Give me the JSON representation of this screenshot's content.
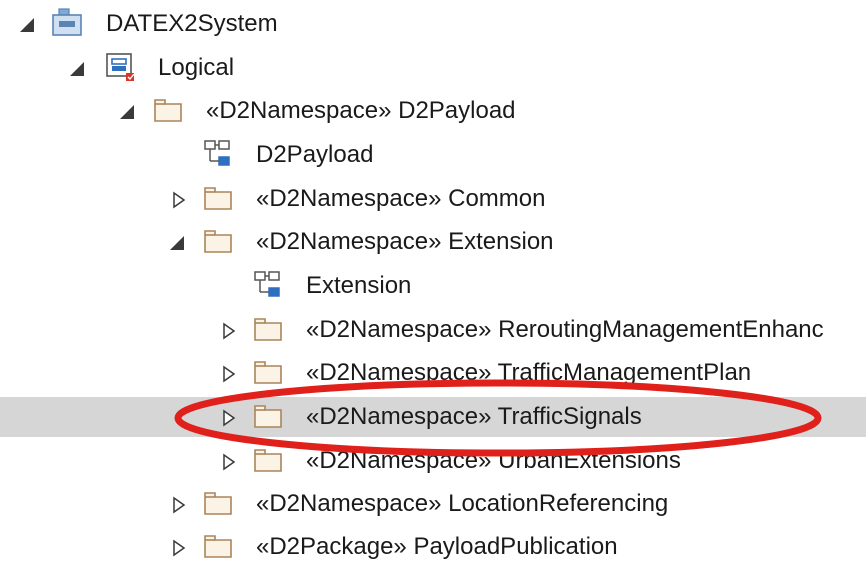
{
  "tree": {
    "items": [
      {
        "label": "DATEX2System",
        "stereotype": "",
        "icon": "model-package-icon",
        "toggle": "expanded",
        "selected": false
      },
      {
        "label": "Logical",
        "stereotype": "",
        "icon": "view-package-icon",
        "toggle": "expanded",
        "selected": false
      },
      {
        "label": "D2Payload",
        "stereotype": "«D2Namespace»",
        "icon": "package-folder-icon",
        "toggle": "expanded",
        "selected": false
      },
      {
        "label": "D2Payload",
        "stereotype": "",
        "icon": "class-diagram-icon",
        "toggle": "none",
        "selected": false
      },
      {
        "label": "Common",
        "stereotype": "«D2Namespace»",
        "icon": "package-folder-icon",
        "toggle": "collapsed",
        "selected": false
      },
      {
        "label": "Extension",
        "stereotype": "«D2Namespace»",
        "icon": "package-folder-icon",
        "toggle": "expanded",
        "selected": false
      },
      {
        "label": "Extension",
        "stereotype": "",
        "icon": "class-diagram-icon",
        "toggle": "none",
        "selected": false
      },
      {
        "label": "ReroutingManagementEnhanc",
        "stereotype": "«D2Namespace»",
        "icon": "package-folder-icon",
        "toggle": "collapsed",
        "selected": false
      },
      {
        "label": "TrafficManagementPlan",
        "stereotype": "«D2Namespace»",
        "icon": "package-folder-icon",
        "toggle": "collapsed",
        "selected": false
      },
      {
        "label": "TrafficSignals",
        "stereotype": "«D2Namespace»",
        "icon": "package-folder-icon",
        "toggle": "collapsed",
        "selected": true
      },
      {
        "label": "UrbanExtensions",
        "stereotype": "«D2Namespace»",
        "icon": "package-folder-icon",
        "toggle": "collapsed",
        "selected": false
      },
      {
        "label": "LocationReferencing",
        "stereotype": "«D2Namespace»",
        "icon": "package-folder-icon",
        "toggle": "collapsed",
        "selected": false
      },
      {
        "label": "PayloadPublication",
        "stereotype": "«D2Package»",
        "icon": "package-folder-icon",
        "toggle": "collapsed",
        "selected": false
      }
    ]
  },
  "annotation": {
    "highlight_color": "#e0201a",
    "highlighted_item": "TrafficSignals"
  },
  "colors": {
    "selection": "#d6d6d6",
    "folder_stroke": "#a9855a",
    "folder_fill": "#fbf3e6",
    "diagram_blue": "#2f6fc0",
    "toggle": "#3a3a3a"
  }
}
